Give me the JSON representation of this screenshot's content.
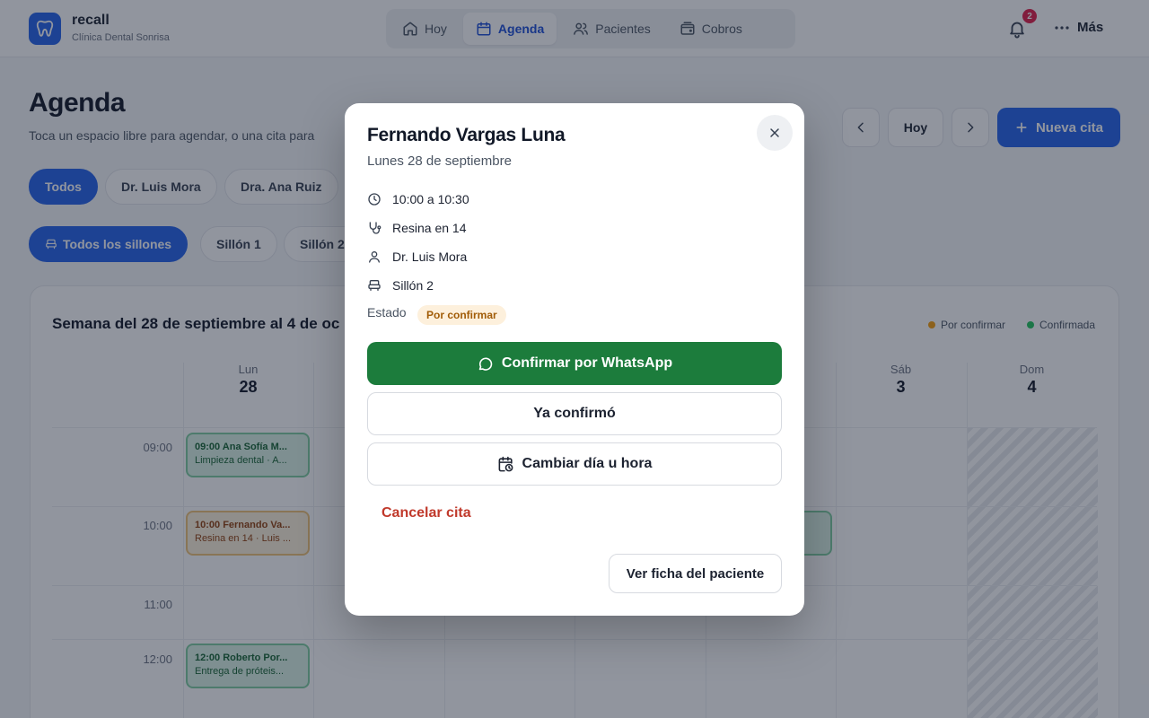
{
  "brand": {
    "name": "recall",
    "clinic": "Clínica Dental Sonrisa"
  },
  "nav": {
    "tabs": [
      {
        "label": "Hoy",
        "icon": "home-icon"
      },
      {
        "label": "Agenda",
        "icon": "calendar-icon",
        "active": true
      },
      {
        "label": "Pacientes",
        "icon": "users-icon"
      },
      {
        "label": "Cobros",
        "icon": "wallet-icon"
      }
    ],
    "notifications": "2",
    "more_label": "Más"
  },
  "page": {
    "title": "Agenda",
    "subtitle": "Toca un espacio libre para agendar, o una cita para",
    "today_label": "Hoy",
    "new_appointment_label": "Nueva cita"
  },
  "filters": {
    "doctors": [
      "Todos",
      "Dr. Luis Mora",
      "Dra. Ana Ruiz"
    ],
    "chairs": [
      "Todos los sillones",
      "Sillón 1",
      "Sillón 2"
    ]
  },
  "calendar": {
    "title": "Semana del 28 de septiembre al 4 de oc",
    "legend": [
      {
        "label": "Por confirmar",
        "color": "#f59e0b"
      },
      {
        "label": "Confirmada",
        "color": "#22c55e"
      }
    ],
    "days": [
      {
        "name": "Lun",
        "num": "28"
      },
      {
        "name": "",
        "num": ""
      },
      {
        "name": "",
        "num": ""
      },
      {
        "name": "",
        "num": ""
      },
      {
        "name": "",
        "num": ""
      },
      {
        "name": "Sáb",
        "num": "3"
      },
      {
        "name": "Dom",
        "num": "4"
      }
    ],
    "times": [
      "09:00",
      "10:00",
      "11:00",
      "12:00"
    ],
    "appointments": [
      {
        "title": "09:00 Ana Sofía M...",
        "sub": "Limpieza dental · A...",
        "status": "green"
      },
      {
        "title": "10:00 Fernando Va...",
        "sub": "Resina en 14 · Luis ...",
        "status": "amber"
      },
      {
        "title": "12:00 Roberto Por...",
        "sub": "Entrega de próteis...",
        "status": "green"
      },
      {
        "title": "...a...",
        "sub": "...a R...",
        "status": "green"
      }
    ]
  },
  "modal": {
    "patient_name": "Fernando Vargas Luna",
    "date": "Lunes 28 de septiembre",
    "time": "10:00 a 10:30",
    "treatment": "Resina en 14",
    "doctor": "Dr. Luis Mora",
    "chair": "Sillón 2",
    "status_label": "Estado",
    "status_value": "Por confirmar",
    "whatsapp_button": "Confirmar por WhatsApp",
    "confirmed_button": "Ya confirmó",
    "reschedule_button": "Cambiar día u hora",
    "cancel_link": "Cancelar cita",
    "patient_record_button": "Ver ficha del paciente"
  },
  "colors": {
    "primary": "#2563eb",
    "whatsapp": "#1c7c3c",
    "danger": "#c0392b",
    "pending": "#f59e0b",
    "confirmed": "#22c55e"
  }
}
